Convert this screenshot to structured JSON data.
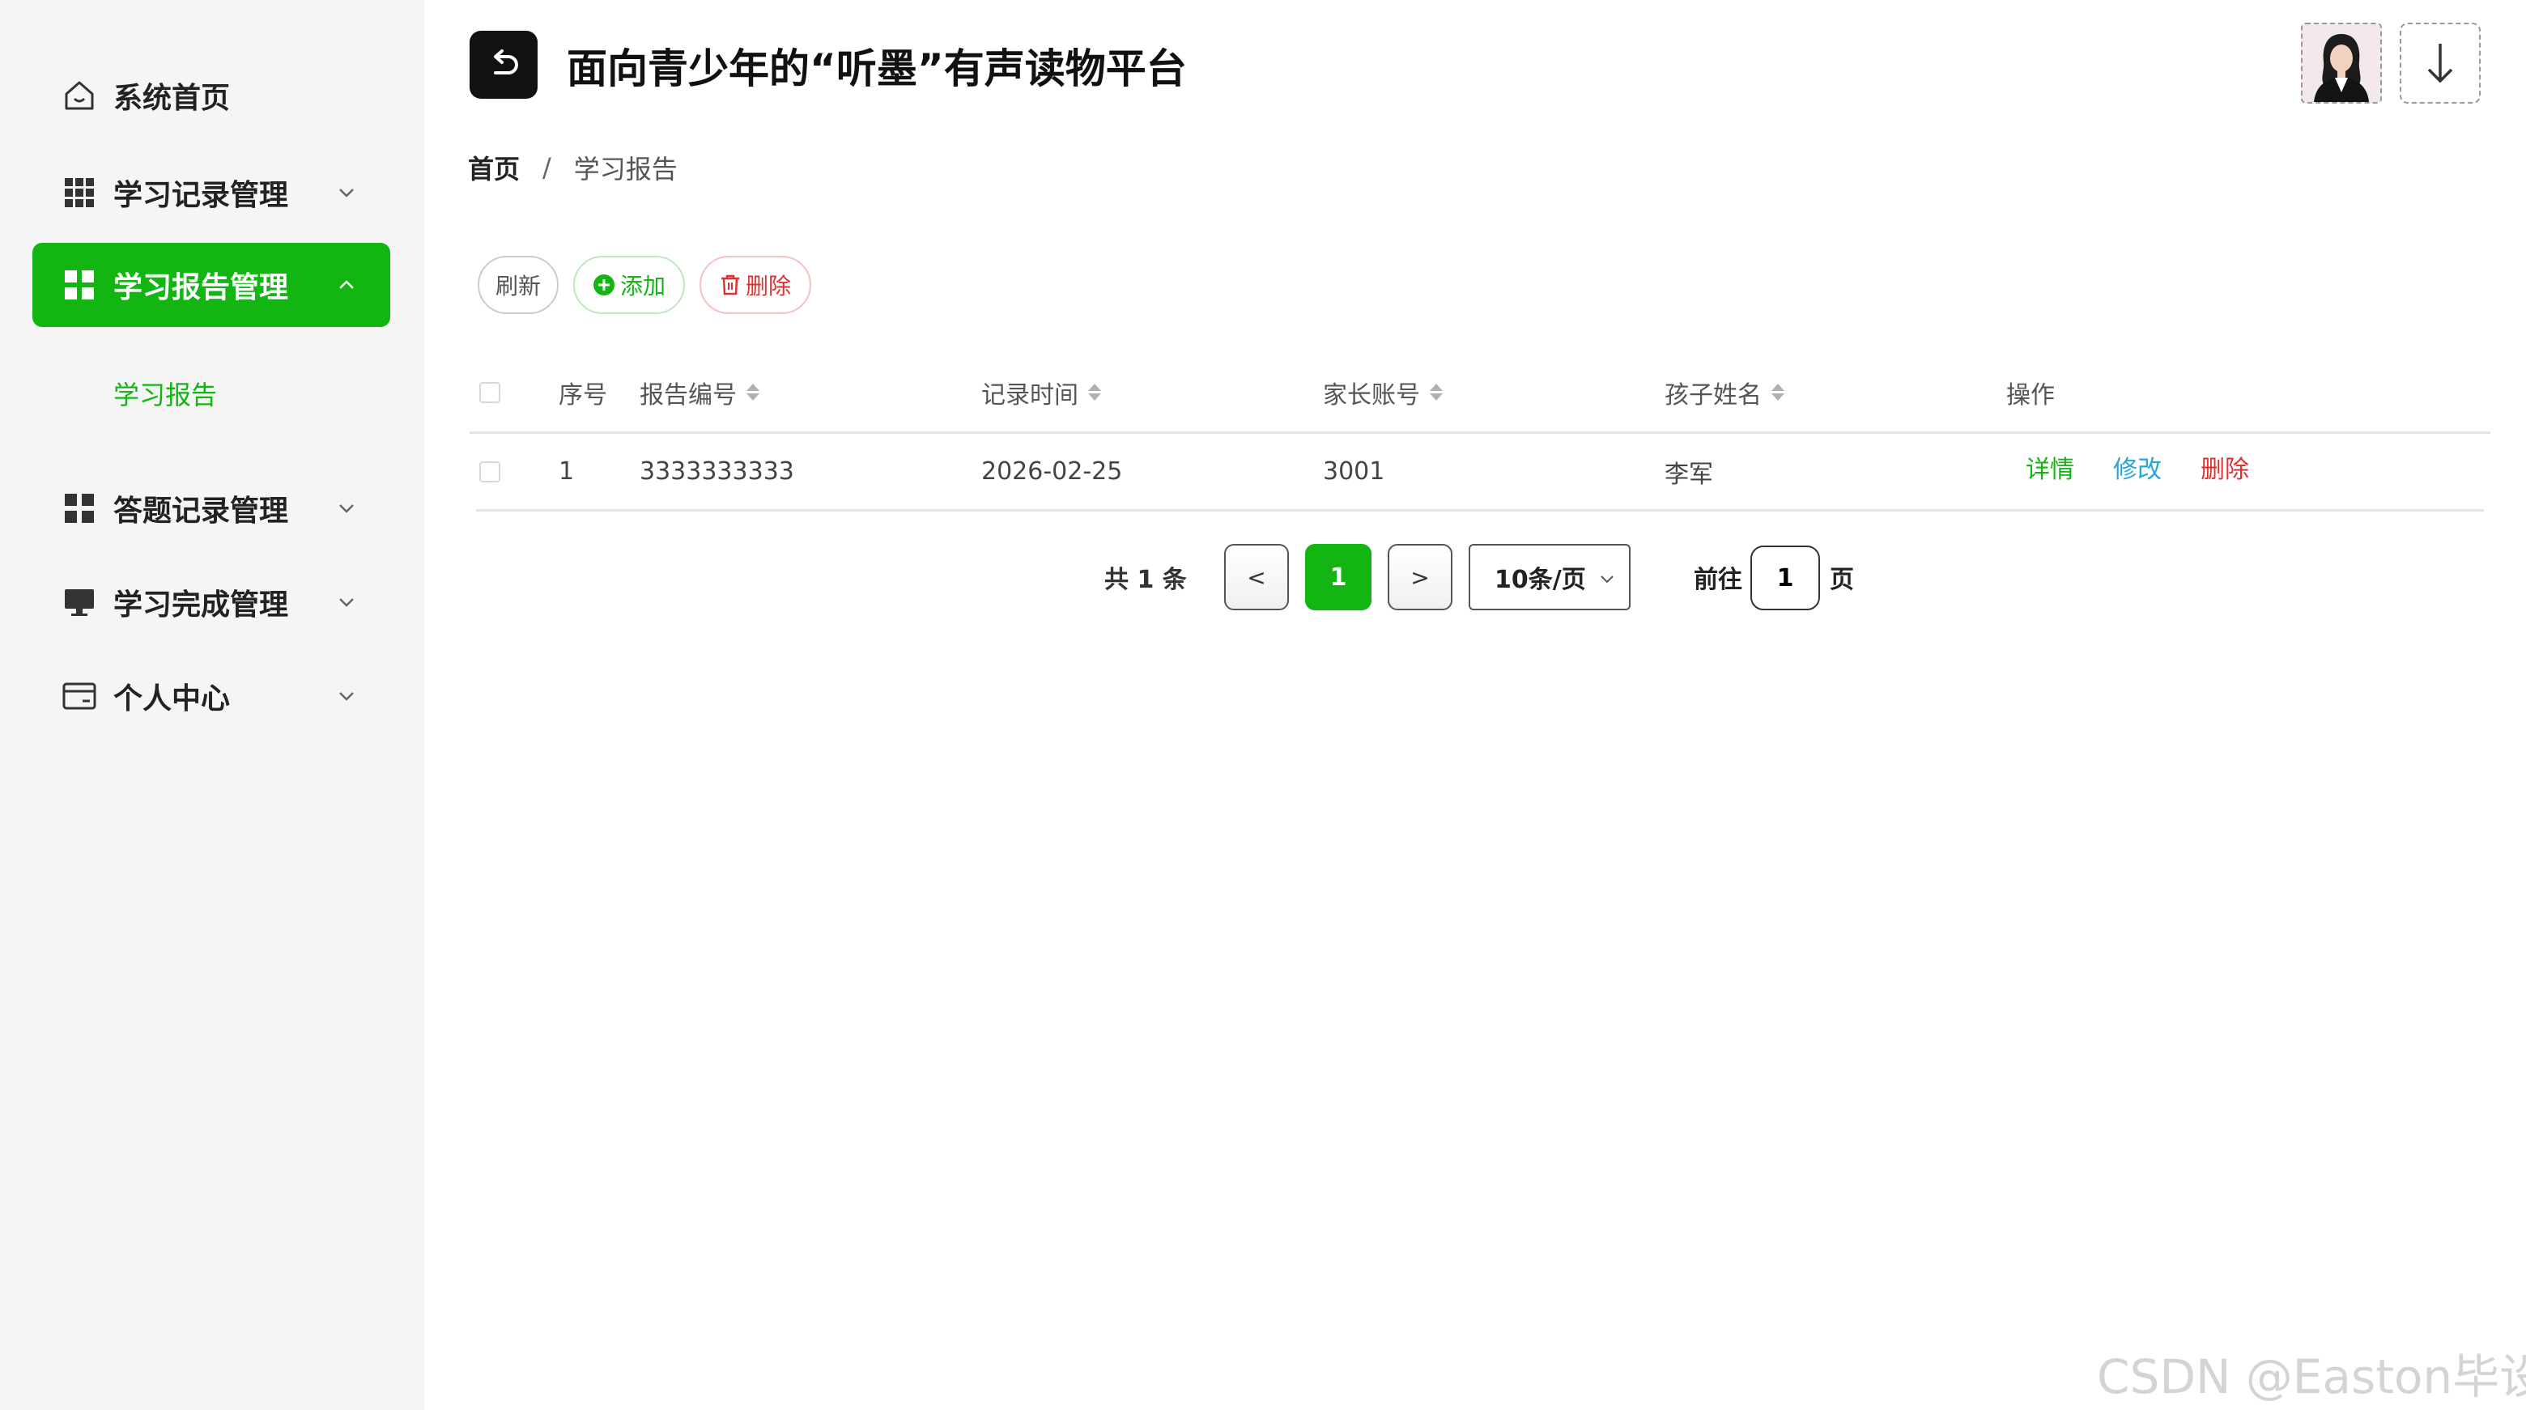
{
  "app": {
    "title": "面向青少年的“听墨”有声读物平台"
  },
  "sidebar": {
    "items": [
      {
        "label": "系统首页",
        "icon": "home-icon"
      },
      {
        "label": "学习记录管理",
        "icon": "grid-9-icon"
      },
      {
        "label": "学习报告管理",
        "icon": "grid-4-icon",
        "active": true
      },
      {
        "label": "答题记录管理",
        "icon": "grid-4-icon"
      },
      {
        "label": "学习完成管理",
        "icon": "monitor-icon"
      },
      {
        "label": "个人中心",
        "icon": "card-icon"
      }
    ],
    "submenu": {
      "label": "学习报告"
    }
  },
  "breadcrumb": {
    "home": "首页",
    "separator": "/",
    "current": "学习报告"
  },
  "toolbar": {
    "refresh": "刷新",
    "add": "添加",
    "delete": "删除"
  },
  "table": {
    "headers": {
      "index": "序号",
      "report_no": "报告编号",
      "record_time": "记录时间",
      "parent_account": "家长账号",
      "child_name": "孩子姓名",
      "actions": "操作"
    },
    "rows": [
      {
        "index": "1",
        "report_no": "3333333333",
        "record_time": "2026-02-25",
        "parent_account": "3001",
        "child_name": "李军"
      }
    ],
    "actions": {
      "detail": "详情",
      "edit": "修改",
      "delete": "删除"
    }
  },
  "pagination": {
    "total": "共 1 条",
    "prev": "<",
    "current": "1",
    "next": ">",
    "page_size": "10条/页",
    "goto_label": "前往",
    "goto_value": "1",
    "goto_suffix": "页"
  },
  "watermark": "CSDN @Easton毕设",
  "colors": {
    "accent": "#12b512",
    "danger": "#e03131",
    "info": "#2ba4d8",
    "sidebar_bg": "#f5f5f5"
  }
}
